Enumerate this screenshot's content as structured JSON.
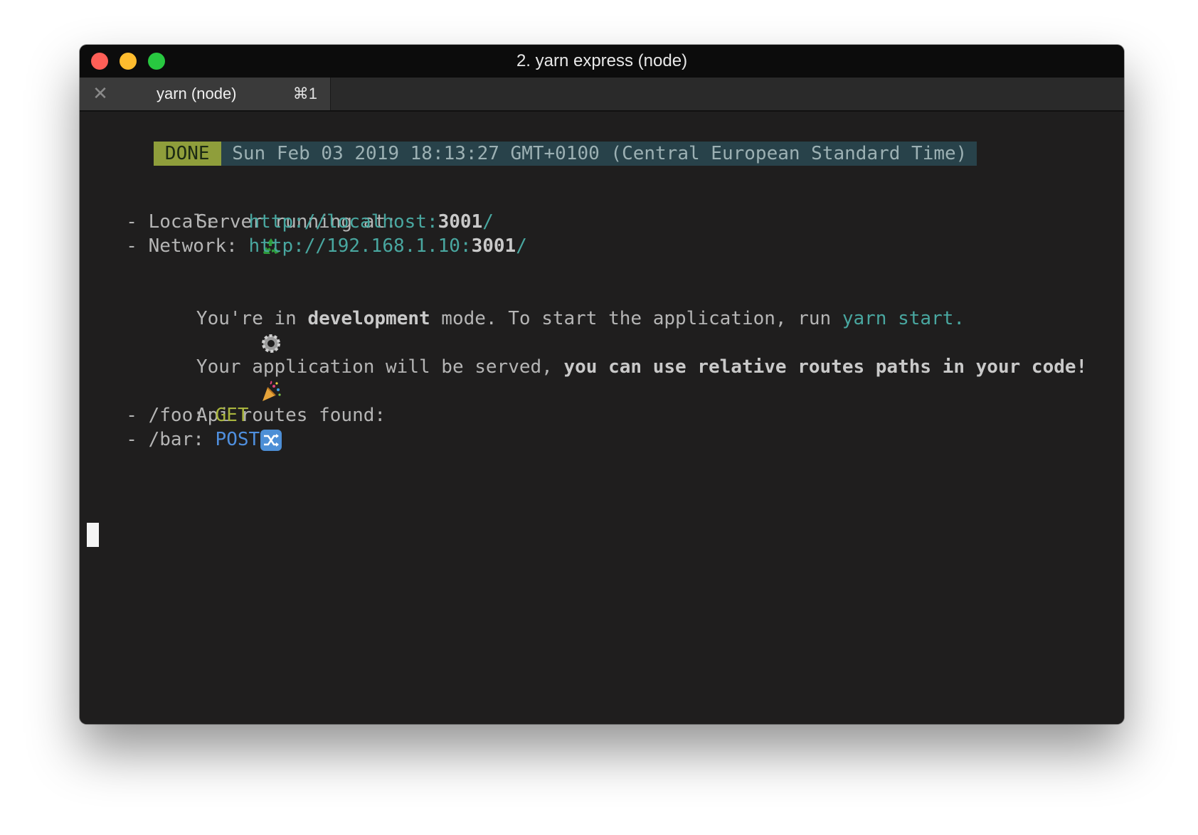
{
  "window": {
    "title": "2. yarn express (node)"
  },
  "tab": {
    "label": "yarn (node)",
    "shortcut": "⌘1"
  },
  "terminal": {
    "done_label": "DONE",
    "timestamp": "Sun Feb 03 2019 18:13:27 GMT+0100 (Central European Standard Time)",
    "server": {
      "icon": "recycle-icon",
      "heading": "Server running at:",
      "local_label": "  - Local:   ",
      "local_url_prefix": "http://localhost:",
      "local_port": "3001",
      "local_url_suffix": "/",
      "network_label": "  - Network: ",
      "network_url_prefix": "http://192.168.1.10:",
      "network_port": "3001",
      "network_url_suffix": "/"
    },
    "mode": {
      "icon": "gear-icon",
      "prefix": "You're in ",
      "mode_word": "development",
      "middle": " mode. To start the application, run ",
      "command": "yarn start",
      "suffix": "."
    },
    "served": {
      "icon": "party-popper-icon",
      "prefix": "Your application will be served, ",
      "emphasis": "you can use relative routes paths in your code!"
    },
    "routes": {
      "icon": "shuffle-icon",
      "heading": "Api routes found:",
      "items": [
        {
          "prefix": "  - /foo: ",
          "method": "GET"
        },
        {
          "prefix": "  - /bar: ",
          "method": "POST"
        }
      ]
    }
  },
  "colors": {
    "background": "#1f1e1e",
    "text": "#b5b5b5",
    "url": "#49a7a0",
    "get": "#a9b53e",
    "post": "#4f8fde",
    "done_badge": "#8f9e3b",
    "done_bar": "#28424a"
  }
}
